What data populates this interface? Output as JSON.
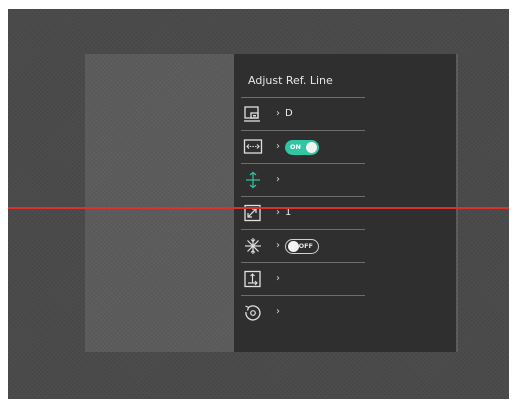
{
  "menu": {
    "title": "Adjust Ref. Line",
    "items": [
      {
        "icon": "picture-in-picture-icon",
        "arrow": "›",
        "value": "D"
      },
      {
        "icon": "horizontal-stretch-icon",
        "arrow": "›",
        "toggle": "ON"
      },
      {
        "icon": "vertical-align-icon",
        "arrow": "›",
        "value": ""
      },
      {
        "icon": "zoom-icon",
        "arrow": "›",
        "value": "1"
      },
      {
        "icon": "freeze-icon",
        "arrow": "›",
        "toggle": "OFF"
      },
      {
        "icon": "frame-adjust-icon",
        "arrow": "›",
        "value": ""
      },
      {
        "icon": "reset-icon",
        "arrow": "›",
        "value": ""
      }
    ]
  },
  "colors": {
    "accent": "#30c5a3",
    "reference_line": "#d7322b",
    "menu_background": "#2f2f2f"
  }
}
